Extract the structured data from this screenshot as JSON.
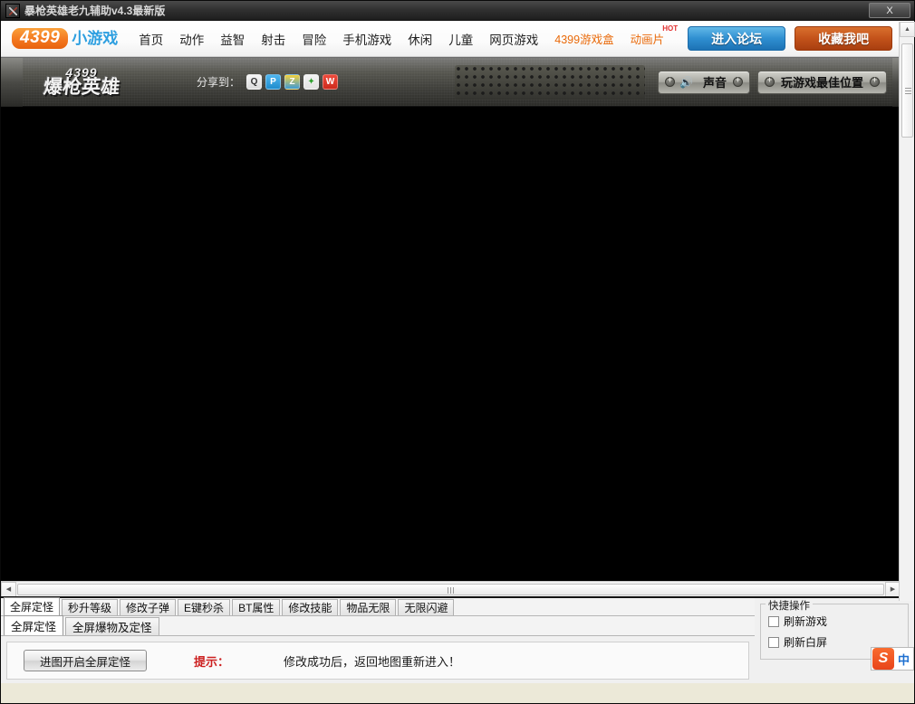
{
  "window": {
    "title": "暴枪英雄老九辅助v4.3最新版",
    "app_icon": "app-icon",
    "close_label": "X"
  },
  "nav": {
    "logo_main": "4399",
    "logo_sub": "小游戏",
    "items": [
      {
        "label": "首页"
      },
      {
        "label": "动作"
      },
      {
        "label": "益智"
      },
      {
        "label": "射击"
      },
      {
        "label": "冒险"
      },
      {
        "label": "手机游戏"
      },
      {
        "label": "休闲"
      },
      {
        "label": "儿童"
      },
      {
        "label": "网页游戏"
      }
    ],
    "promo_box": "4399游戏盒",
    "promo_anime": "动画片",
    "promo_anime_badge": "HOT",
    "forum_button": "进入论坛",
    "favorite_button": "收藏我吧"
  },
  "banner": {
    "game_logo_number": "4399",
    "game_logo_name": "爆枪英雄",
    "share_label": "分享到：",
    "share_icons": [
      {
        "name": "qq-share-icon",
        "glyph": "Q"
      },
      {
        "name": "qzone-share-icon",
        "glyph": "P"
      },
      {
        "name": "zone-share-icon",
        "glyph": "Z"
      },
      {
        "name": "renren-share-icon",
        "glyph": "✦"
      },
      {
        "name": "weibo-share-icon",
        "glyph": "W"
      }
    ],
    "sound_button": "声音",
    "sound_icon": "speaker-icon",
    "position_button": "玩游戏最佳位置"
  },
  "tabs_primary": [
    {
      "label": "全屏定怪",
      "active": true
    },
    {
      "label": "秒升等级",
      "active": false
    },
    {
      "label": "修改子弹",
      "active": false
    },
    {
      "label": "E键秒杀",
      "active": false
    },
    {
      "label": "BT属性",
      "active": false
    },
    {
      "label": "修改技能",
      "active": false
    },
    {
      "label": "物品无限",
      "active": false
    },
    {
      "label": "无限闪避",
      "active": false
    }
  ],
  "tabs_secondary": [
    {
      "label": "全屏定怪",
      "active": true
    },
    {
      "label": "全屏爆物及定怪",
      "active": false
    }
  ],
  "panel": {
    "action_button": "进图开启全屏定怪",
    "hint_label": "提示：",
    "hint_text": "修改成功后，返回地图重新进入！"
  },
  "quick_actions": {
    "group_title": "快捷操作",
    "items": [
      {
        "label": "刷新游戏",
        "checked": false
      },
      {
        "label": "刷新白屏",
        "checked": false
      }
    ]
  },
  "ime": {
    "logo": "S",
    "mode": "中"
  },
  "scrollbars": {
    "vertical_up": "▲",
    "horizontal_left": "◀",
    "horizontal_right": "▶"
  }
}
